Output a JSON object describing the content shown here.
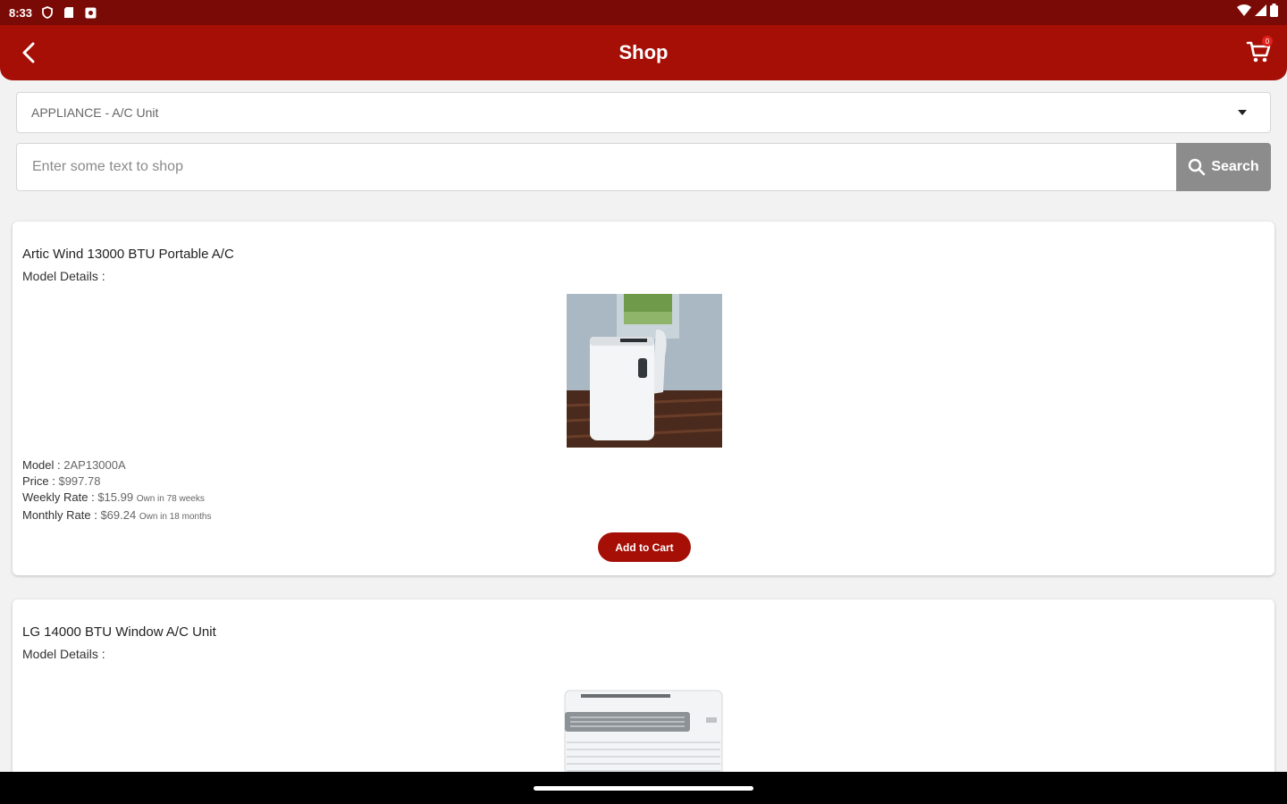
{
  "status_bar": {
    "time": "8:33"
  },
  "app_bar": {
    "title": "Shop",
    "cart_count": "0"
  },
  "filter": {
    "category": "APPLIANCE - A/C Unit"
  },
  "search": {
    "placeholder": "Enter some text to shop",
    "value": "",
    "button_label": "Search"
  },
  "products": [
    {
      "name": "Artic Wind 13000 BTU Portable A/C",
      "model_details_label": "Model Details :",
      "model_label": "Model :",
      "model": "2AP13000A",
      "price_label": "Price :",
      "price": "$997.78",
      "weekly_label": "Weekly Rate :",
      "weekly_rate": "$15.99",
      "weekly_note": "Own in 78 weeks",
      "monthly_label": "Monthly Rate :",
      "monthly_rate": "$69.24",
      "monthly_note": "Own in 18 months",
      "add_to_cart_label": "Add to Cart"
    },
    {
      "name": "LG 14000 BTU Window A/C Unit",
      "model_details_label": "Model Details :"
    }
  ],
  "colors": {
    "primary": "#a50f06",
    "status_bar": "#7a0a05",
    "search_button": "#8c8c8c"
  }
}
